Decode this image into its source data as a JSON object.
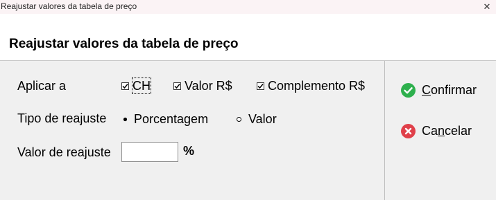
{
  "window": {
    "title": "Reajustar valores da tabela de preço",
    "close_glyph": "✕"
  },
  "header": {
    "heading": "Reajustar valores da tabela de preço"
  },
  "form": {
    "apply_label": "Aplicar a",
    "checkboxes": [
      {
        "label": "CH",
        "checked": true
      },
      {
        "label": "Valor R$",
        "checked": true
      },
      {
        "label": "Complemento R$",
        "checked": true
      }
    ],
    "type_label": "Tipo de reajuste",
    "radios": [
      {
        "label": "Porcentagem",
        "selected": true
      },
      {
        "label": "Valor",
        "selected": false
      }
    ],
    "value_label": "Valor de reajuste",
    "value_input": "",
    "value_unit": "%"
  },
  "actions": {
    "confirm": {
      "before": "",
      "accel": "C",
      "after": "onfirmar",
      "icon": "check-circle-icon",
      "color": "#2eb04d"
    },
    "cancel": {
      "before": "Ca",
      "accel": "n",
      "after": "celar",
      "icon": "x-circle-icon",
      "color": "#e0404a"
    }
  }
}
